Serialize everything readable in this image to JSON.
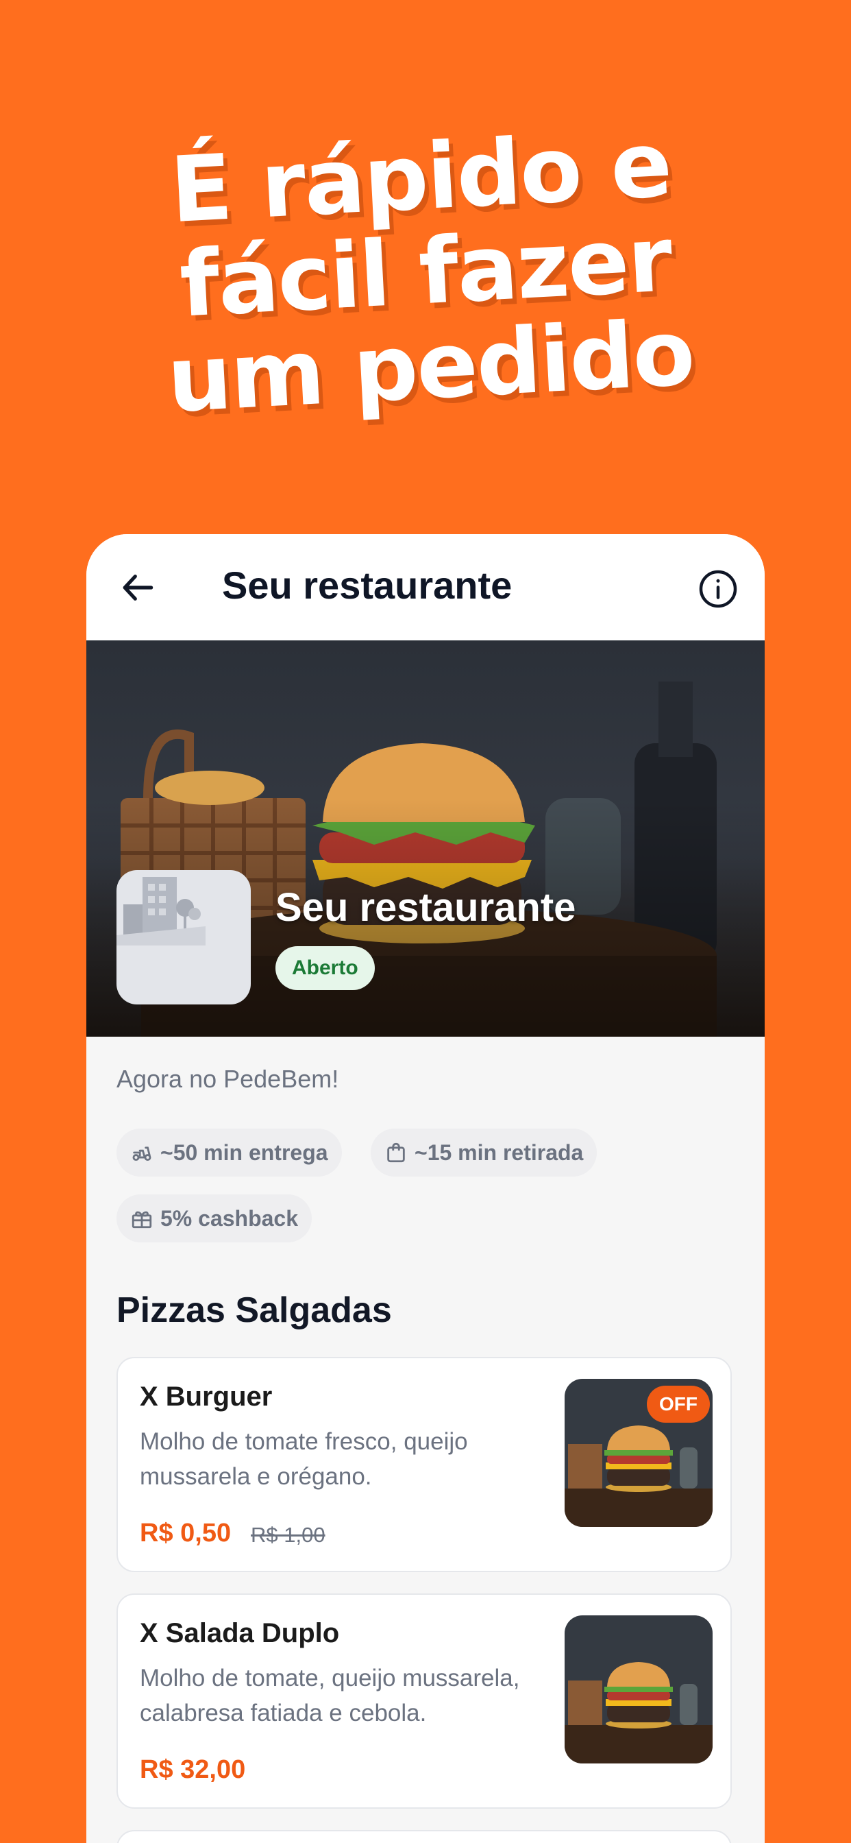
{
  "headline": [
    "É rápido e",
    "fácil fazer",
    "um pedido"
  ],
  "topbar": {
    "title": "Seu restaurante"
  },
  "restaurant": {
    "name": "Seu restaurante",
    "status": "Aberto",
    "description": "Agora no PedeBem!"
  },
  "info_chips": [
    {
      "icon": "scooter-icon",
      "label": "~50 min entrega"
    },
    {
      "icon": "shopping-bag-icon",
      "label": "~15 min retirada"
    },
    {
      "icon": "gift-icon",
      "label": "5% cashback"
    }
  ],
  "section": {
    "title": "Pizzas Salgadas"
  },
  "products": [
    {
      "name": "X Burguer",
      "description": "Molho de tomate fresco, queijo mussarela e orégano.",
      "price": "R$ 0,50",
      "old_price": "R$ 1,00",
      "badge": "OFF"
    },
    {
      "name": "X Salada Duplo",
      "description": "Molho de tomate, queijo mussarela, calabresa fatiada e cebola.",
      "price": "R$ 32,00"
    }
  ],
  "colors": {
    "background": "#FF6E1E",
    "accent": "#F05A14",
    "open_badge": "#1B7A36"
  }
}
